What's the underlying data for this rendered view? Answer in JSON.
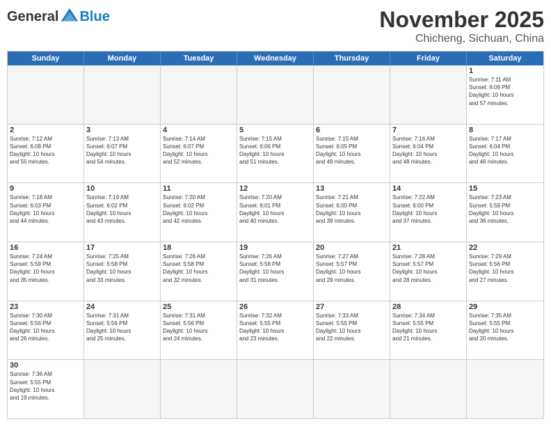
{
  "header": {
    "logo_general": "General",
    "logo_blue": "Blue",
    "month_title": "November 2025",
    "location": "Chicheng, Sichuan, China"
  },
  "days_of_week": [
    "Sunday",
    "Monday",
    "Tuesday",
    "Wednesday",
    "Thursday",
    "Friday",
    "Saturday"
  ],
  "weeks": [
    [
      {
        "day": "",
        "info": ""
      },
      {
        "day": "",
        "info": ""
      },
      {
        "day": "",
        "info": ""
      },
      {
        "day": "",
        "info": ""
      },
      {
        "day": "",
        "info": ""
      },
      {
        "day": "",
        "info": ""
      },
      {
        "day": "1",
        "info": "Sunrise: 7:11 AM\nSunset: 6:09 PM\nDaylight: 10 hours\nand 57 minutes."
      }
    ],
    [
      {
        "day": "2",
        "info": "Sunrise: 7:12 AM\nSunset: 6:08 PM\nDaylight: 10 hours\nand 55 minutes."
      },
      {
        "day": "3",
        "info": "Sunrise: 7:13 AM\nSunset: 6:07 PM\nDaylight: 10 hours\nand 54 minutes."
      },
      {
        "day": "4",
        "info": "Sunrise: 7:14 AM\nSunset: 6:07 PM\nDaylight: 10 hours\nand 52 minutes."
      },
      {
        "day": "5",
        "info": "Sunrise: 7:15 AM\nSunset: 6:06 PM\nDaylight: 10 hours\nand 51 minutes."
      },
      {
        "day": "6",
        "info": "Sunrise: 7:15 AM\nSunset: 6:05 PM\nDaylight: 10 hours\nand 49 minutes."
      },
      {
        "day": "7",
        "info": "Sunrise: 7:16 AM\nSunset: 6:04 PM\nDaylight: 10 hours\nand 48 minutes."
      },
      {
        "day": "8",
        "info": "Sunrise: 7:17 AM\nSunset: 6:04 PM\nDaylight: 10 hours\nand 46 minutes."
      }
    ],
    [
      {
        "day": "9",
        "info": "Sunrise: 7:18 AM\nSunset: 6:03 PM\nDaylight: 10 hours\nand 44 minutes."
      },
      {
        "day": "10",
        "info": "Sunrise: 7:19 AM\nSunset: 6:02 PM\nDaylight: 10 hours\nand 43 minutes."
      },
      {
        "day": "11",
        "info": "Sunrise: 7:20 AM\nSunset: 6:02 PM\nDaylight: 10 hours\nand 42 minutes."
      },
      {
        "day": "12",
        "info": "Sunrise: 7:20 AM\nSunset: 6:01 PM\nDaylight: 10 hours\nand 40 minutes."
      },
      {
        "day": "13",
        "info": "Sunrise: 7:21 AM\nSunset: 6:00 PM\nDaylight: 10 hours\nand 39 minutes."
      },
      {
        "day": "14",
        "info": "Sunrise: 7:22 AM\nSunset: 6:00 PM\nDaylight: 10 hours\nand 37 minutes."
      },
      {
        "day": "15",
        "info": "Sunrise: 7:23 AM\nSunset: 5:59 PM\nDaylight: 10 hours\nand 36 minutes."
      }
    ],
    [
      {
        "day": "16",
        "info": "Sunrise: 7:24 AM\nSunset: 5:59 PM\nDaylight: 10 hours\nand 35 minutes."
      },
      {
        "day": "17",
        "info": "Sunrise: 7:25 AM\nSunset: 5:58 PM\nDaylight: 10 hours\nand 33 minutes."
      },
      {
        "day": "18",
        "info": "Sunrise: 7:26 AM\nSunset: 5:58 PM\nDaylight: 10 hours\nand 32 minutes."
      },
      {
        "day": "19",
        "info": "Sunrise: 7:26 AM\nSunset: 5:58 PM\nDaylight: 10 hours\nand 31 minutes."
      },
      {
        "day": "20",
        "info": "Sunrise: 7:27 AM\nSunset: 5:57 PM\nDaylight: 10 hours\nand 29 minutes."
      },
      {
        "day": "21",
        "info": "Sunrise: 7:28 AM\nSunset: 5:57 PM\nDaylight: 10 hours\nand 28 minutes."
      },
      {
        "day": "22",
        "info": "Sunrise: 7:29 AM\nSunset: 5:56 PM\nDaylight: 10 hours\nand 27 minutes."
      }
    ],
    [
      {
        "day": "23",
        "info": "Sunrise: 7:30 AM\nSunset: 5:56 PM\nDaylight: 10 hours\nand 26 minutes."
      },
      {
        "day": "24",
        "info": "Sunrise: 7:31 AM\nSunset: 5:56 PM\nDaylight: 10 hours\nand 25 minutes."
      },
      {
        "day": "25",
        "info": "Sunrise: 7:31 AM\nSunset: 5:56 PM\nDaylight: 10 hours\nand 24 minutes."
      },
      {
        "day": "26",
        "info": "Sunrise: 7:32 AM\nSunset: 5:55 PM\nDaylight: 10 hours\nand 23 minutes."
      },
      {
        "day": "27",
        "info": "Sunrise: 7:33 AM\nSunset: 5:55 PM\nDaylight: 10 hours\nand 22 minutes."
      },
      {
        "day": "28",
        "info": "Sunrise: 7:34 AM\nSunset: 5:55 PM\nDaylight: 10 hours\nand 21 minutes."
      },
      {
        "day": "29",
        "info": "Sunrise: 7:35 AM\nSunset: 5:55 PM\nDaylight: 10 hours\nand 20 minutes."
      }
    ],
    [
      {
        "day": "30",
        "info": "Sunrise: 7:36 AM\nSunset: 5:55 PM\nDaylight: 10 hours\nand 19 minutes."
      },
      {
        "day": "",
        "info": ""
      },
      {
        "day": "",
        "info": ""
      },
      {
        "day": "",
        "info": ""
      },
      {
        "day": "",
        "info": ""
      },
      {
        "day": "",
        "info": ""
      },
      {
        "day": "",
        "info": ""
      }
    ]
  ]
}
